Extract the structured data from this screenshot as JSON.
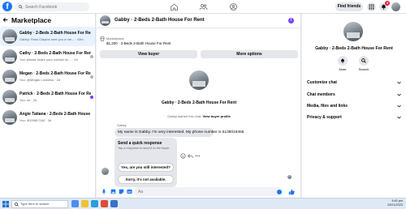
{
  "topbar": {
    "logo": "f",
    "search_placeholder": "Search Facebook",
    "find_friends": "Find friends",
    "notification_count": "3"
  },
  "left": {
    "title": "Marketplace",
    "conversations": [
      {
        "title": "Gabby · 2-Beds 2-Bath House For Rent",
        "snippet": "Gabby: Ross Clayton sent you a me... · 43m",
        "active": true,
        "dot": "none"
      },
      {
        "title": "Cathy · 2-Beds 2-Bath House For Rent",
        "snippet": "You: please share your contact nu... · 2d",
        "active": false,
        "dot": "gray"
      },
      {
        "title": "Megan · 2-Beds 2-Bath House For Rent",
        "snippet": "You: @Megan Loveless · 2d",
        "active": false,
        "dot": "gray"
      },
      {
        "title": "Patrick · 2-Beds 2-Bath House For Rent",
        "snippet": "You: ok · 2d",
        "active": false,
        "dot": "purple"
      },
      {
        "title": "Angie Tatiana · 2-Beds 2-Bath House For Rent",
        "snippet": "You: 5029967160 · 3d",
        "active": false,
        "dot": "none"
      }
    ]
  },
  "chat": {
    "title": "Gabby · 2-Beds 2-Bath House For Rent",
    "info_icon": "i",
    "marketplace_label": "Marketplace",
    "listing": "$1,200 · 2-Beds 2-Bath House For Rent",
    "view_buyer": "View buyer",
    "more_options": "More options",
    "center_title": "Gabby · 2-Beds 2-Bath House For Rent",
    "system_prefix": "Gabby started this chat.",
    "system_link": "View buyer profile",
    "sender": "Gabby",
    "message": "My name is Gabby. I'm very interested. My phone number is 5138018455",
    "quick_title": "Send a quick response",
    "quick_sub": "Tap a response to send it to the buyer.",
    "quick_options": [
      "Yes, are you still interested?",
      "Sorry, it's not available."
    ],
    "composer_placeholder": "Aa"
  },
  "right": {
    "title": "Gabby · 2-Beds 2-Bath House For Rent",
    "actions": [
      "Mute",
      "Search"
    ],
    "sections": [
      "Customize chat",
      "Chat members",
      "Media, files and links",
      "Privacy & support"
    ]
  },
  "taskbar": {
    "search_text": "Type here to search",
    "time": "3:45 pm",
    "date": "23/01/2023"
  },
  "colors": {
    "brand": "#1877f2",
    "accent_purple": "#7b3ff2",
    "badge_red": "#e41e3f"
  }
}
